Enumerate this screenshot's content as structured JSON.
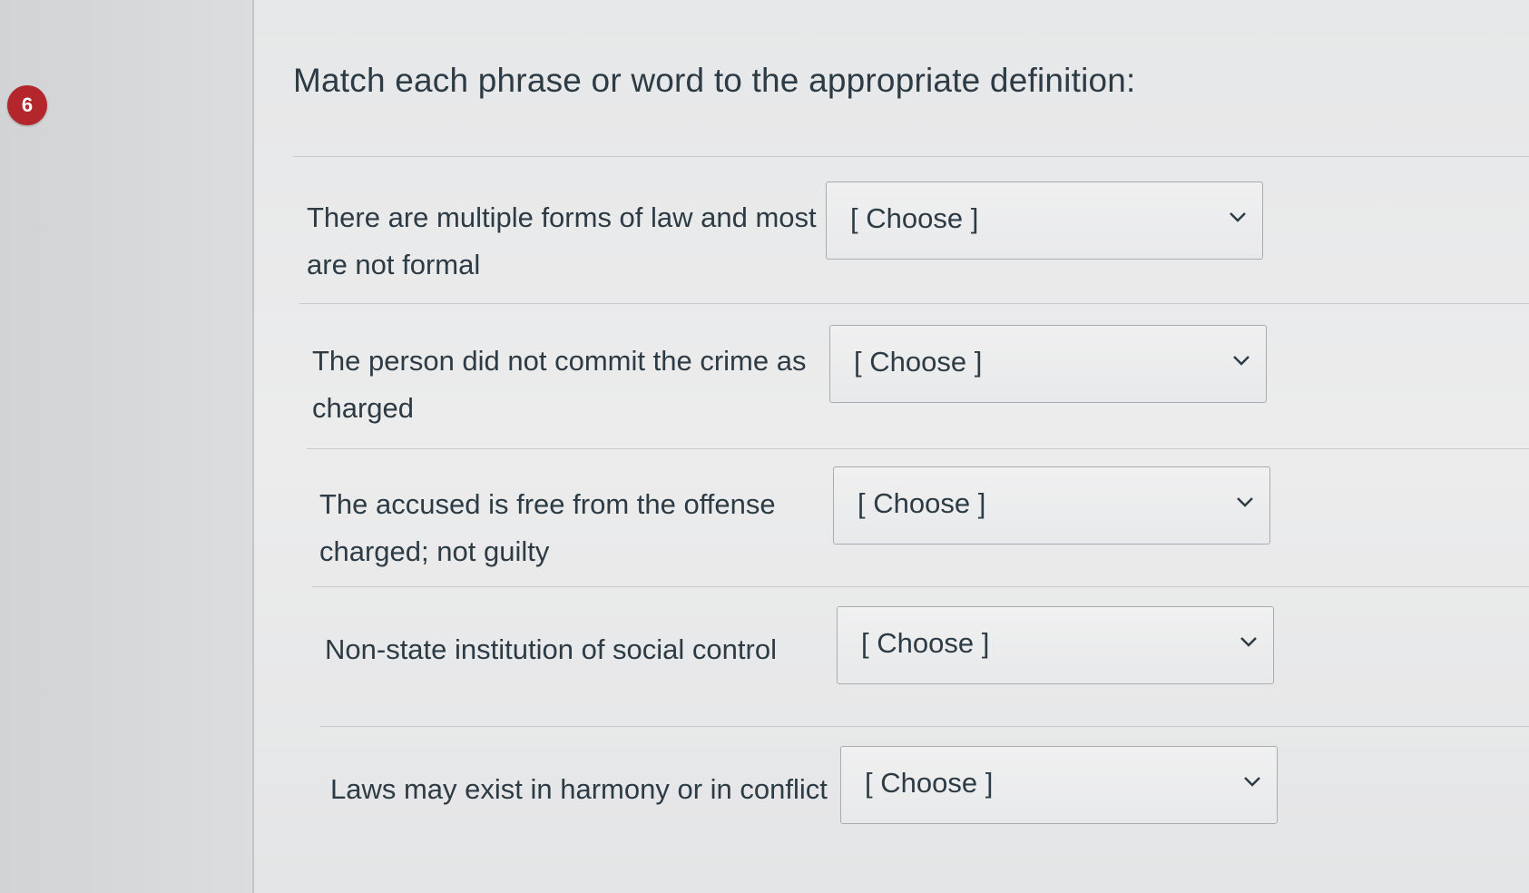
{
  "question": {
    "number": "6",
    "text": "Match each phrase or word to the appropriate definition:"
  },
  "items": [
    {
      "prompt": "There are multiple forms of law and most are not formal",
      "selected": "[ Choose ]"
    },
    {
      "prompt": "The person did not commit the crime as charged",
      "selected": "[ Choose ]"
    },
    {
      "prompt": "The accused is free from the offense charged; not guilty",
      "selected": "[ Choose ]"
    },
    {
      "prompt": "Non-state institution of social control",
      "selected": "[ Choose ]"
    },
    {
      "prompt": "Laws may exist in harmony or in conflict",
      "selected": "[ Choose ]"
    }
  ],
  "icons": {
    "select_arrow": "chevron-down-icon"
  },
  "colors": {
    "badge": "#b3262b",
    "text": "#2d3b45"
  }
}
